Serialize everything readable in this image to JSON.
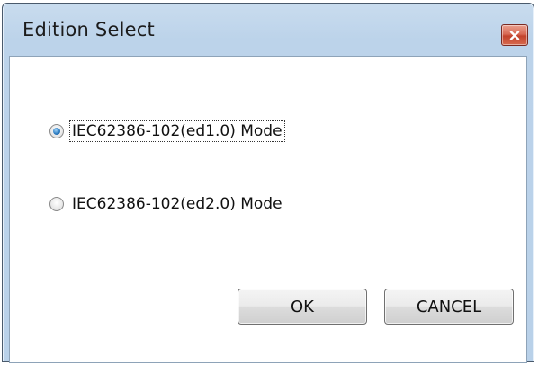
{
  "window": {
    "title": "Edition Select",
    "close_icon": "close-icon"
  },
  "options": [
    {
      "label": "IEC62386-102(ed1.0) Mode",
      "checked": true,
      "focused": true
    },
    {
      "label": "IEC62386-102(ed2.0) Mode",
      "checked": false,
      "focused": false
    }
  ],
  "buttons": {
    "ok_label": "OK",
    "cancel_label": "CANCEL"
  },
  "colors": {
    "titlebar": "#bcd3ea",
    "close_button": "#c2422c",
    "radio_selected": "#2f7fc4"
  }
}
